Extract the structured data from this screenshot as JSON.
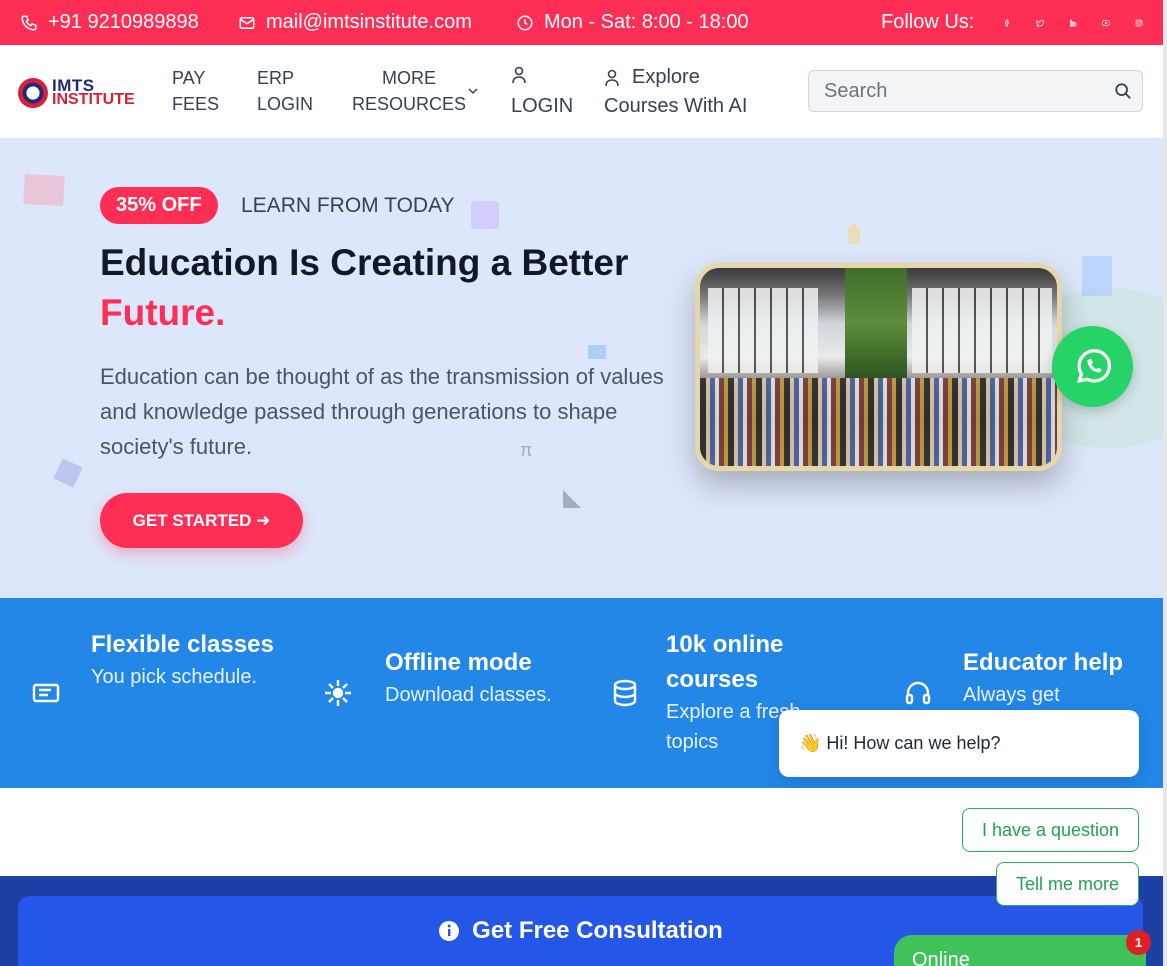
{
  "topbar": {
    "phone": "+91 9210989898",
    "email": "mail@imtsinstitute.com",
    "hours": "Mon - Sat: 8:00 - 18:00",
    "follow_label": "Follow Us:",
    "socials": [
      "facebook-icon",
      "twitter-icon",
      "linkedin-icon",
      "youtube-icon",
      "instagram-icon"
    ]
  },
  "header": {
    "logo_top": "IMTS",
    "logo_bottom": "INSTITUTE",
    "nav": {
      "pay_fees_1": "PAY",
      "pay_fees_2": "FEES",
      "erp_1": "ERP",
      "erp_2": "LOGIN",
      "more_1": "MORE",
      "more_2": "RESOURCES",
      "login": "LOGIN",
      "explore_1": "Explore",
      "explore_2": "Courses With AI"
    },
    "search_placeholder": "Search"
  },
  "hero": {
    "badge": "35% OFF",
    "tagline": "LEARN FROM TODAY",
    "title_line1": "Education Is Creating a Better",
    "title_line2": "Future.",
    "description": "Education can be thought of as the transmission of values and knowledge passed through generations to shape society's future.",
    "cta": "GET STARTED ➜"
  },
  "features": [
    {
      "title": "Flexible classes",
      "desc": "You pick schedule.",
      "icon": "tablet-icon"
    },
    {
      "title": "Offline mode",
      "desc": "Download classes.",
      "icon": "sparkle-icon"
    },
    {
      "title": "10k online courses",
      "desc": "Explore a fresh topics",
      "icon": "database-icon"
    },
    {
      "title": "Educator help",
      "desc": "Always get",
      "icon": "headset-icon"
    }
  ],
  "chat": {
    "greeting": "👋 Hi! How can we help?",
    "option1": "I have a question",
    "option2": "Tell me more",
    "status": "Online",
    "badge_count": "1"
  },
  "consultation": {
    "label": "Get Free Consultation"
  },
  "colors": {
    "accent": "#ff2e55",
    "band": "#2387e8",
    "whatsapp": "#25d366"
  }
}
